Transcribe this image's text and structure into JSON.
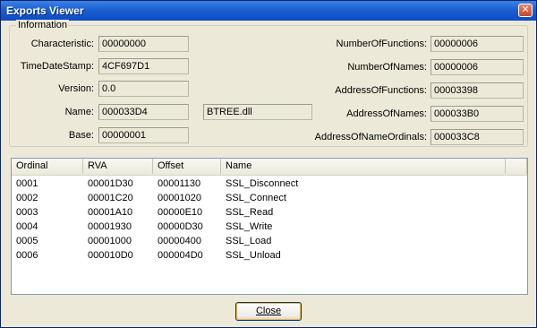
{
  "window": {
    "title": "Exports Viewer",
    "close_glyph": "✕"
  },
  "info": {
    "legend": "Information",
    "left": [
      {
        "label": "Characteristic:",
        "value": "00000000"
      },
      {
        "label": "TimeDateStamp:",
        "value": "4CF697D1"
      },
      {
        "label": "Version:",
        "value": "0.0"
      },
      {
        "label": "Name:",
        "value": "000033D4",
        "extra": "BTREE.dll"
      },
      {
        "label": "Base:",
        "value": "00000001"
      }
    ],
    "right": [
      {
        "label": "NumberOfFunctions:",
        "value": "00000006"
      },
      {
        "label": "NumberOfNames:",
        "value": "00000006"
      },
      {
        "label": "AddressOfFunctions:",
        "value": "00003398"
      },
      {
        "label": "AddressOfNames:",
        "value": "000033B0"
      },
      {
        "label": "AddressOfNameOrdinals:",
        "value": "000033C8"
      }
    ]
  },
  "table": {
    "columns": [
      "Ordinal",
      "RVA",
      "Offset",
      "Name"
    ],
    "rows": [
      [
        "0001",
        "00001D30",
        "00001130",
        "SSL_Disconnect"
      ],
      [
        "0002",
        "00001C20",
        "00001020",
        "SSL_Connect"
      ],
      [
        "0003",
        "00001A10",
        "00000E10",
        "SSL_Read"
      ],
      [
        "0004",
        "00001930",
        "00000D30",
        "SSL_Write"
      ],
      [
        "0005",
        "00001000",
        "00000400",
        "SSL_Load"
      ],
      [
        "0006",
        "000010D0",
        "000004D0",
        "SSL_Unload"
      ]
    ]
  },
  "buttons": {
    "close": "Close"
  }
}
